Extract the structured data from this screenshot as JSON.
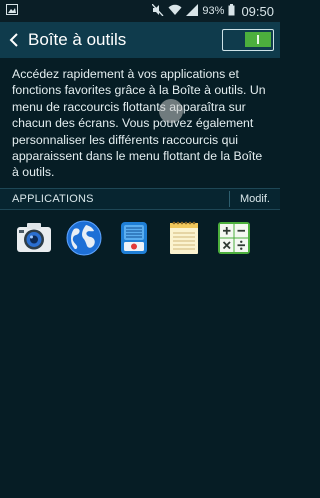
{
  "status_bar": {
    "battery_percent": "93%",
    "time": "09:50",
    "icons": [
      "image-icon",
      "mute-icon",
      "wifi-icon",
      "signal-icon",
      "battery-icon"
    ]
  },
  "header": {
    "title": "Boîte à outils",
    "toggle_on": true
  },
  "description": "Accédez rapidement à vos applications et fonctions favorites grâce à la Boîte à outils. Un menu de raccourcis flottants apparaîtra sur chacun des écrans. Vous pouvez également personnaliser les différents raccourcis qui apparaissent dans le menu flottant de la Boîte à outils.",
  "applications": {
    "section_label": "APPLICATIONS",
    "edit_label": "Modif.",
    "apps": [
      "camera-icon",
      "internet-icon",
      "voice-recorder-icon",
      "memo-icon",
      "calculator-icon"
    ]
  },
  "colors": {
    "background": "#061d25",
    "header": "#0f3b4c",
    "toggle_on": "#4caf3d"
  }
}
